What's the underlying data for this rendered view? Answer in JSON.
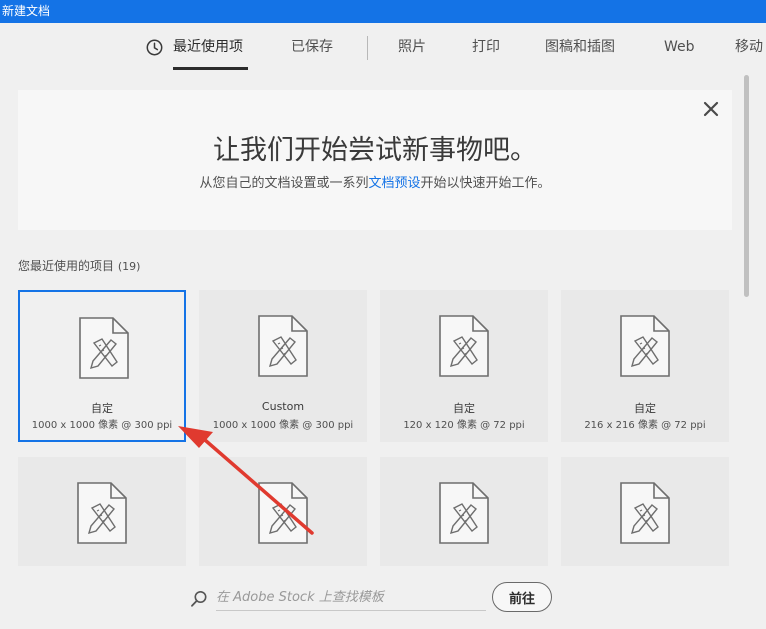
{
  "window": {
    "title": "新建文档"
  },
  "tabs": [
    {
      "label": "最近使用项",
      "active": true
    },
    {
      "label": "已保存"
    },
    {
      "label": "照片"
    },
    {
      "label": "打印"
    },
    {
      "label": "图稿和插图"
    },
    {
      "label": "Web"
    },
    {
      "label": "移动"
    }
  ],
  "hero": {
    "title": "让我们开始尝试新事物吧。",
    "subtitle_before": "从您自己的文档设置或一系列",
    "subtitle_link": "文档预设",
    "subtitle_after": "开始以快速开始工作。"
  },
  "recent": {
    "label": "您最近使用的项目",
    "count": "(19)",
    "items": [
      {
        "name": "自定",
        "dims": "1000 x 1000 像素 @ 300 ppi",
        "selected": true
      },
      {
        "name": "Custom",
        "dims": "1000 x 1000 像素 @ 300 ppi"
      },
      {
        "name": "自定",
        "dims": "120 x 120 像素 @ 72 ppi"
      },
      {
        "name": "自定",
        "dims": "216 x 216 像素 @ 72 ppi"
      },
      {
        "name": "",
        "dims": ""
      },
      {
        "name": "",
        "dims": ""
      },
      {
        "name": "",
        "dims": ""
      },
      {
        "name": "",
        "dims": ""
      }
    ]
  },
  "stock": {
    "placeholder": "在 Adobe Stock 上查找模板",
    "go_label": "前往"
  },
  "colors": {
    "accent": "#1473e6",
    "arrow": "#e03a2f"
  }
}
